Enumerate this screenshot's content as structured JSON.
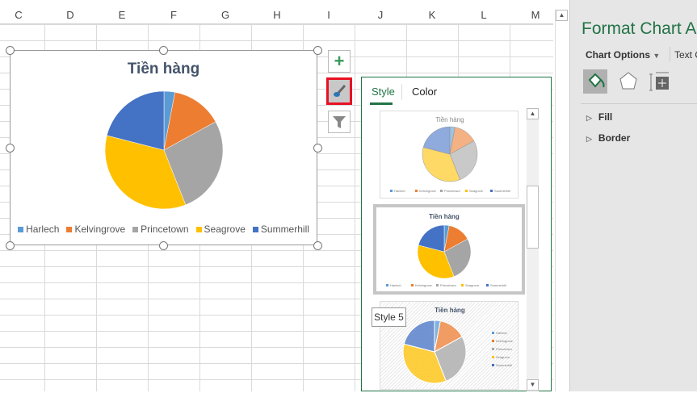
{
  "columns": [
    "C",
    "D",
    "E",
    "F",
    "G",
    "H",
    "I",
    "J",
    "K",
    "L",
    "M"
  ],
  "chart_data": {
    "type": "pie",
    "title": "Tiền hàng",
    "categories": [
      "Harlech",
      "Kelvingrove",
      "Princetown",
      "Seagrove",
      "Summerhill"
    ],
    "values": [
      3,
      14,
      27,
      35,
      21
    ],
    "colors": [
      "#5b9bd5",
      "#ed7d31",
      "#a5a5a5",
      "#ffc000",
      "#4472c4"
    ],
    "legend": "bottom"
  },
  "chart_buttons": {
    "elements": "plus-icon",
    "styles": "paintbrush-icon",
    "filters": "funnel-icon"
  },
  "style_panel": {
    "tabs": [
      "Style",
      "Color"
    ],
    "active_tab": "Style",
    "thumb_title": "Tiền hàng",
    "tooltip": "Style 5"
  },
  "format_pane": {
    "title": "Format Chart Ar",
    "options_label": "Chart Options",
    "text_options_label": "Text O",
    "sections": [
      "Fill",
      "Border"
    ]
  },
  "highlight_color": "#e81123",
  "accent": "#217346"
}
